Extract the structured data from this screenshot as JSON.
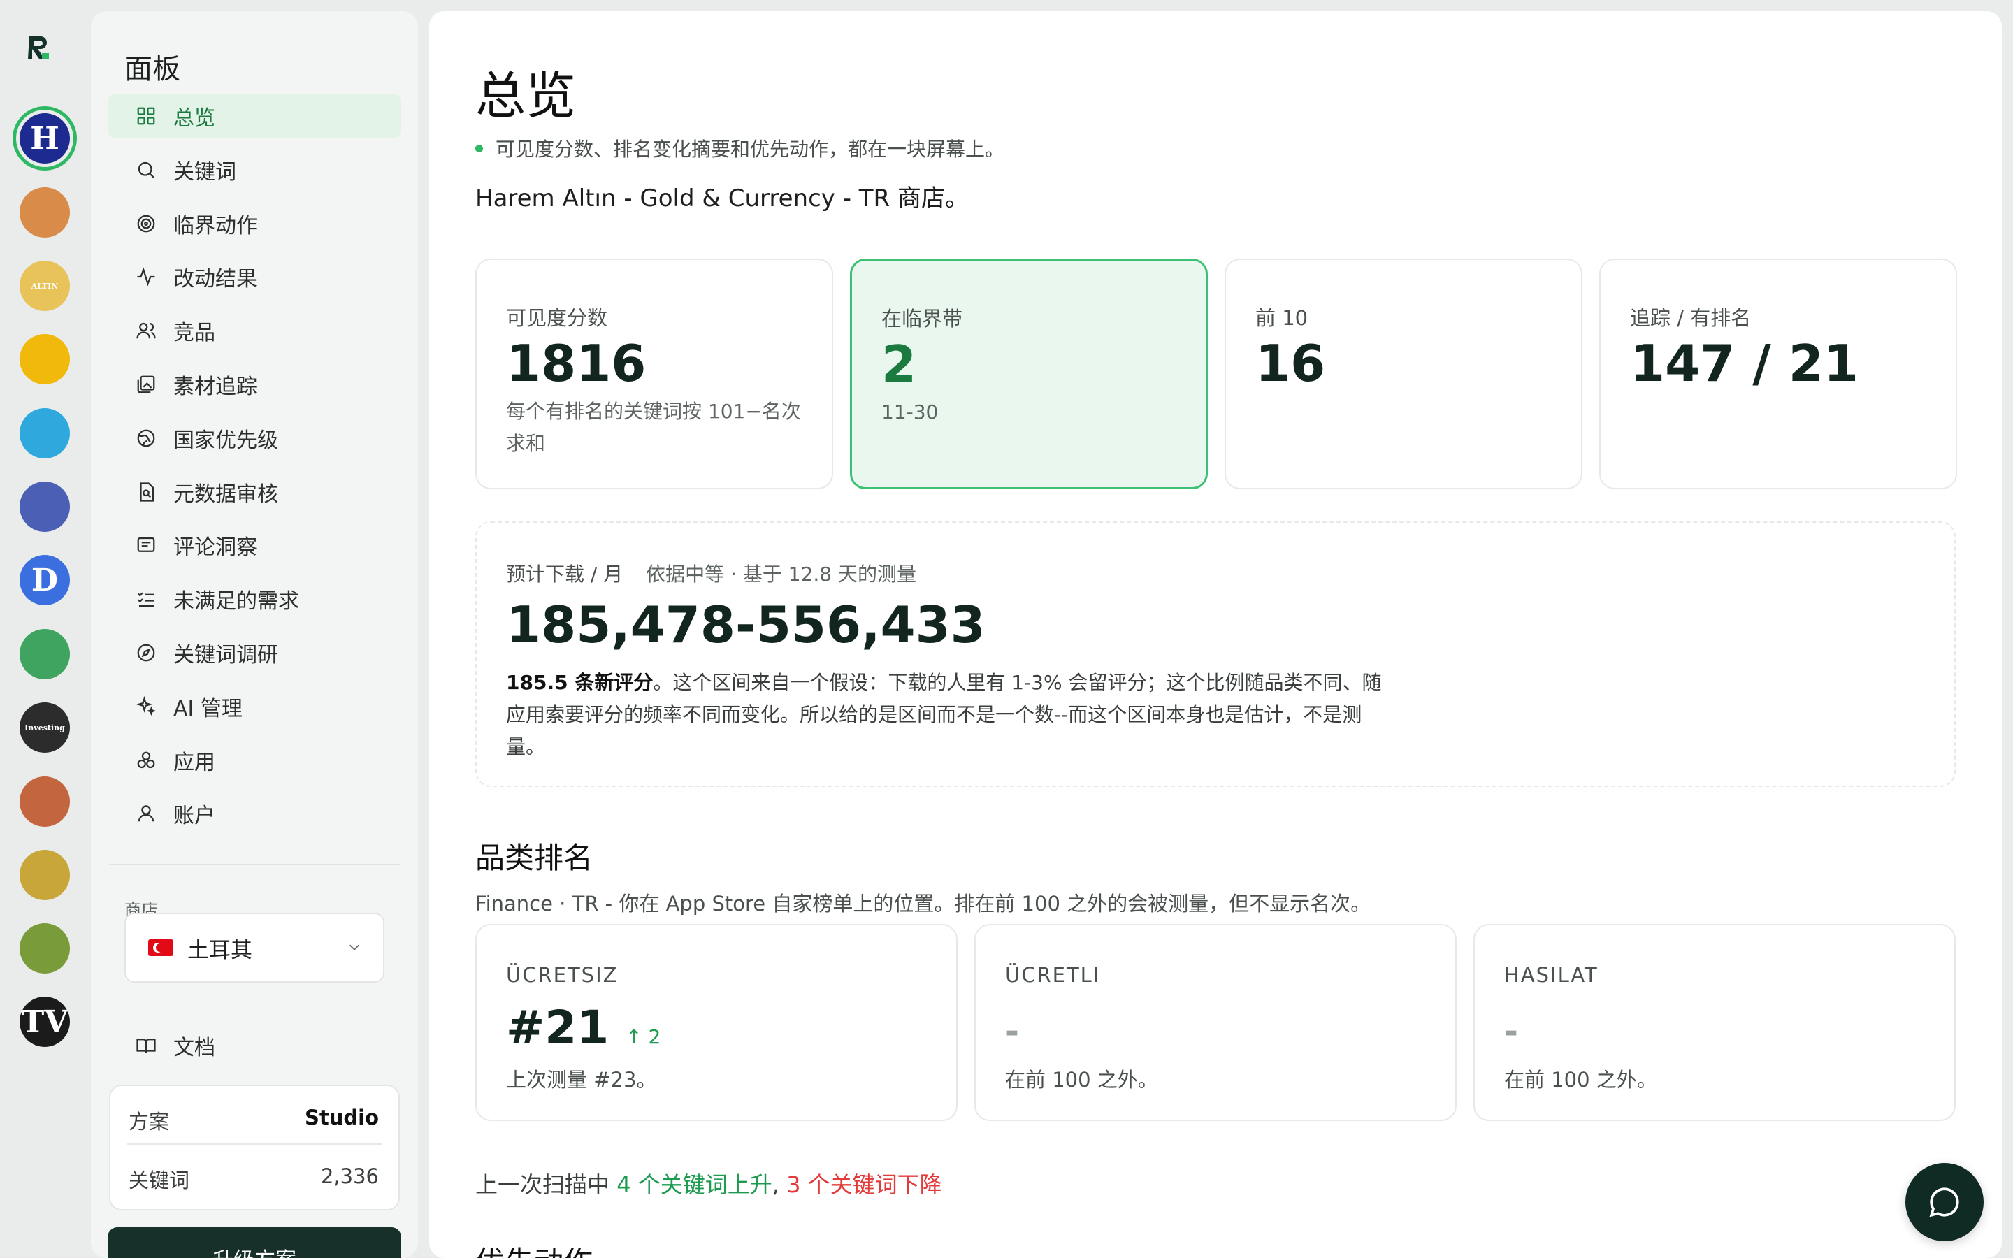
{
  "rail": {
    "logo": "R",
    "apps": [
      {
        "name": "Harem Altın",
        "glyph": "H",
        "color": "#1d2a8f",
        "active": true
      },
      {
        "name": "app-2",
        "glyph": "",
        "color": "#d98b4a"
      },
      {
        "name": "app-3",
        "glyph": "ALTIN",
        "color": "#e7c35a"
      },
      {
        "name": "app-4",
        "glyph": "",
        "color": "#f0b90b"
      },
      {
        "name": "app-5",
        "glyph": "",
        "color": "#2fa9dd"
      },
      {
        "name": "app-6",
        "glyph": "",
        "color": "#4b5fb4"
      },
      {
        "name": "app-7",
        "glyph": "D",
        "color": "#3b6fe0"
      },
      {
        "name": "app-8",
        "glyph": "",
        "color": "#3fa45f"
      },
      {
        "name": "app-9",
        "glyph": "Investing",
        "color": "#2c2c2c"
      },
      {
        "name": "app-10",
        "glyph": "",
        "color": "#c3653e"
      },
      {
        "name": "app-11",
        "glyph": "",
        "color": "#c9a63a"
      },
      {
        "name": "app-12",
        "glyph": "",
        "color": "#7a9b3a"
      },
      {
        "name": "app-13",
        "glyph": "TV",
        "color": "#1b1b1b"
      }
    ]
  },
  "sidebar": {
    "title": "面板",
    "nav": [
      {
        "label": "总览",
        "icon": "grid-icon",
        "active": true
      },
      {
        "label": "关键词",
        "icon": "search-icon"
      },
      {
        "label": "临界动作",
        "icon": "target-icon"
      },
      {
        "label": "改动结果",
        "icon": "activity-icon"
      },
      {
        "label": "竞品",
        "icon": "users-icon"
      },
      {
        "label": "素材追踪",
        "icon": "images-icon"
      },
      {
        "label": "国家优先级",
        "icon": "globe-icon"
      },
      {
        "label": "元数据审核",
        "icon": "file-search-icon"
      },
      {
        "label": "评论洞察",
        "icon": "message-icon"
      },
      {
        "label": "未满足的需求",
        "icon": "list-check-icon"
      },
      {
        "label": "关键词调研",
        "icon": "compass-icon"
      },
      {
        "label": "AI 管理",
        "icon": "sparkles-icon"
      },
      {
        "label": "应用",
        "icon": "apps-icon"
      },
      {
        "label": "账户",
        "icon": "user-icon"
      }
    ],
    "store_label": "商店",
    "store_value": "土耳其",
    "docs_label": "文档",
    "plan": {
      "plan_label": "方案",
      "plan_value": "Studio",
      "keywords_label": "关键词",
      "keywords_value": "2,336"
    },
    "upgrade_label": "升级方案"
  },
  "main": {
    "title": "总览",
    "subtitle": "可见度分数、排名变化摘要和优先动作，都在一块屏幕上。",
    "store_line": "Harem Altın - Gold & Currency - TR 商店。",
    "stats": [
      {
        "label": "可见度分数",
        "value": "1816",
        "note": "每个有排名的关键词按 101−名次 求和",
        "highlight": false
      },
      {
        "label": "在临界带",
        "value": "2",
        "note": "11-30",
        "highlight": true
      },
      {
        "label": "前 10",
        "value": "16",
        "note": "",
        "highlight": false
      },
      {
        "label": "追踪 / 有排名",
        "value": "147 / 21",
        "note": "",
        "highlight": false
      }
    ],
    "downloads": {
      "label": "预计下载 / 月",
      "meta": "依据中等 · 基于 12.8 天的测量",
      "value": "185,478-556,433",
      "note_strong": "185.5 条新评分",
      "note": "。这个区间来自一个假设：下载的人里有 1-3% 会留评分；这个比例随品类不同、随应用索要评分的频率不同而变化。所以给的是区间而不是一个数--而这个区间本身也是估计，不是测量。"
    },
    "category": {
      "title": "品类排名",
      "subtitle": "Finance · TR - 你在 App Store 自家榜单上的位置。排在前 100 之外的会被测量，但不显示名次。",
      "cards": [
        {
          "label": "ÜCRETSIZ",
          "value": "#21",
          "delta": "↑ 2",
          "note": "上次测量 #23。"
        },
        {
          "label": "ÜCRETLI",
          "value": "-",
          "delta": "",
          "note": "在前 100 之外。"
        },
        {
          "label": "HASILAT",
          "value": "-",
          "delta": "",
          "note": "在前 100 之外。"
        }
      ]
    },
    "scan": {
      "prefix": "上一次扫描中 ",
      "up": "4 个关键词上升",
      "sep": ", ",
      "down": "3 个关键词下降"
    },
    "next_title": "优先动作"
  }
}
